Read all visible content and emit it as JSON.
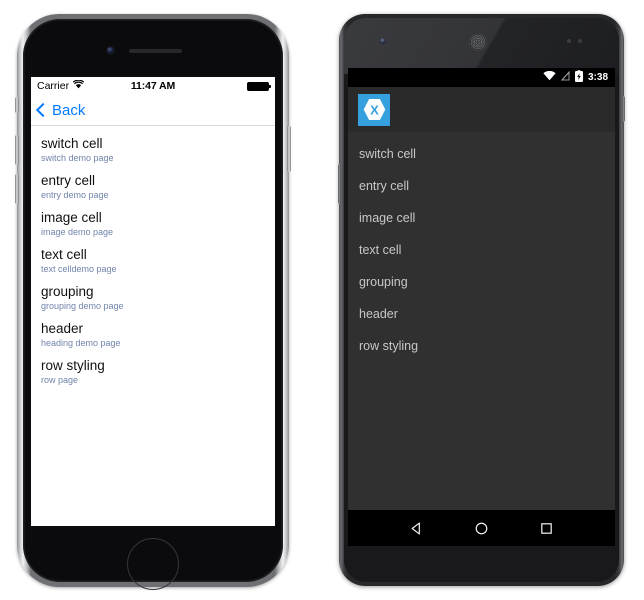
{
  "ios": {
    "status_bar": {
      "carrier": "Carrier",
      "wifi_icon": "wifi-icon",
      "time": "11:47 AM",
      "battery_icon": "battery-full-icon"
    },
    "nav_bar": {
      "back_icon": "chevron-left-icon",
      "back_label": "Back"
    },
    "list": [
      {
        "title": "switch cell",
        "subtitle": "switch demo page"
      },
      {
        "title": "entry cell",
        "subtitle": "entry demo page"
      },
      {
        "title": "image cell",
        "subtitle": "image demo page"
      },
      {
        "title": "text cell",
        "subtitle": "text celldemo page"
      },
      {
        "title": "grouping",
        "subtitle": "grouping demo page"
      },
      {
        "title": "header",
        "subtitle": "heading demo page"
      },
      {
        "title": "row styling",
        "subtitle": "row page"
      }
    ],
    "colors": {
      "accent": "#027aff",
      "title": "#111111",
      "subtitle": "#7184ab",
      "background": "#ffffff"
    }
  },
  "android": {
    "status_bar": {
      "wifi_icon": "wifi-icon",
      "signal_icon": "signal-off-icon",
      "battery_icon": "battery-charging-icon",
      "time": "3:38"
    },
    "action_bar": {
      "logo_icon": "xamarin-logo-icon",
      "logo_letter": "X"
    },
    "list": [
      {
        "title": "switch cell"
      },
      {
        "title": "entry cell"
      },
      {
        "title": "image cell"
      },
      {
        "title": "text cell"
      },
      {
        "title": "grouping"
      },
      {
        "title": "header"
      },
      {
        "title": "row styling"
      }
    ],
    "nav_bar": {
      "back_icon": "nav-back-triangle-icon",
      "home_icon": "nav-home-circle-icon",
      "recents_icon": "nav-recents-square-icon"
    },
    "colors": {
      "logo_blue": "#34a0dd",
      "action_bar": "#2a2a2a",
      "list_background": "#303030",
      "list_text": "#c7c7c7",
      "system_bar": "#000000"
    }
  }
}
